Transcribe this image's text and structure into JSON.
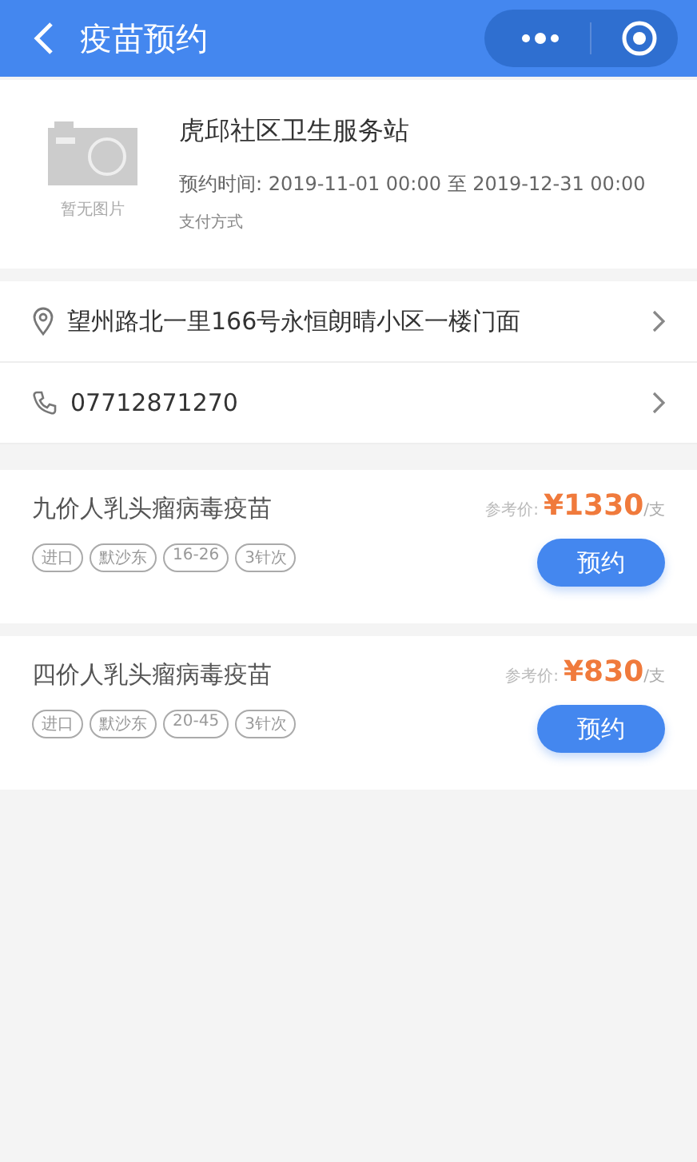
{
  "header": {
    "title": "疫苗预约"
  },
  "clinic": {
    "image_caption": "暂无图片",
    "name": "虎邱社区卫生服务站",
    "time": "预约时间: 2019-11-01 00:00 至 2019-12-31 00:00",
    "payment": "支付方式"
  },
  "contacts": [
    {
      "kind": "address",
      "text": "望州路北一里166号永恒朗晴小区一楼门面"
    },
    {
      "kind": "phone",
      "text": "07712871270"
    }
  ],
  "vaccines": [
    {
      "name": "九价人乳头瘤病毒疫苗",
      "price_label": "参考价:",
      "price": "¥1330",
      "unit": "/支",
      "tags": [
        "进口",
        "默沙东",
        "16-26",
        "3针次"
      ],
      "button": "预约"
    },
    {
      "name": "四价人乳头瘤病毒疫苗",
      "price_label": "参考价:",
      "price": "¥830",
      "unit": "/支",
      "tags": [
        "进口",
        "默沙东",
        "20-45",
        "3针次"
      ],
      "button": "预约"
    }
  ]
}
